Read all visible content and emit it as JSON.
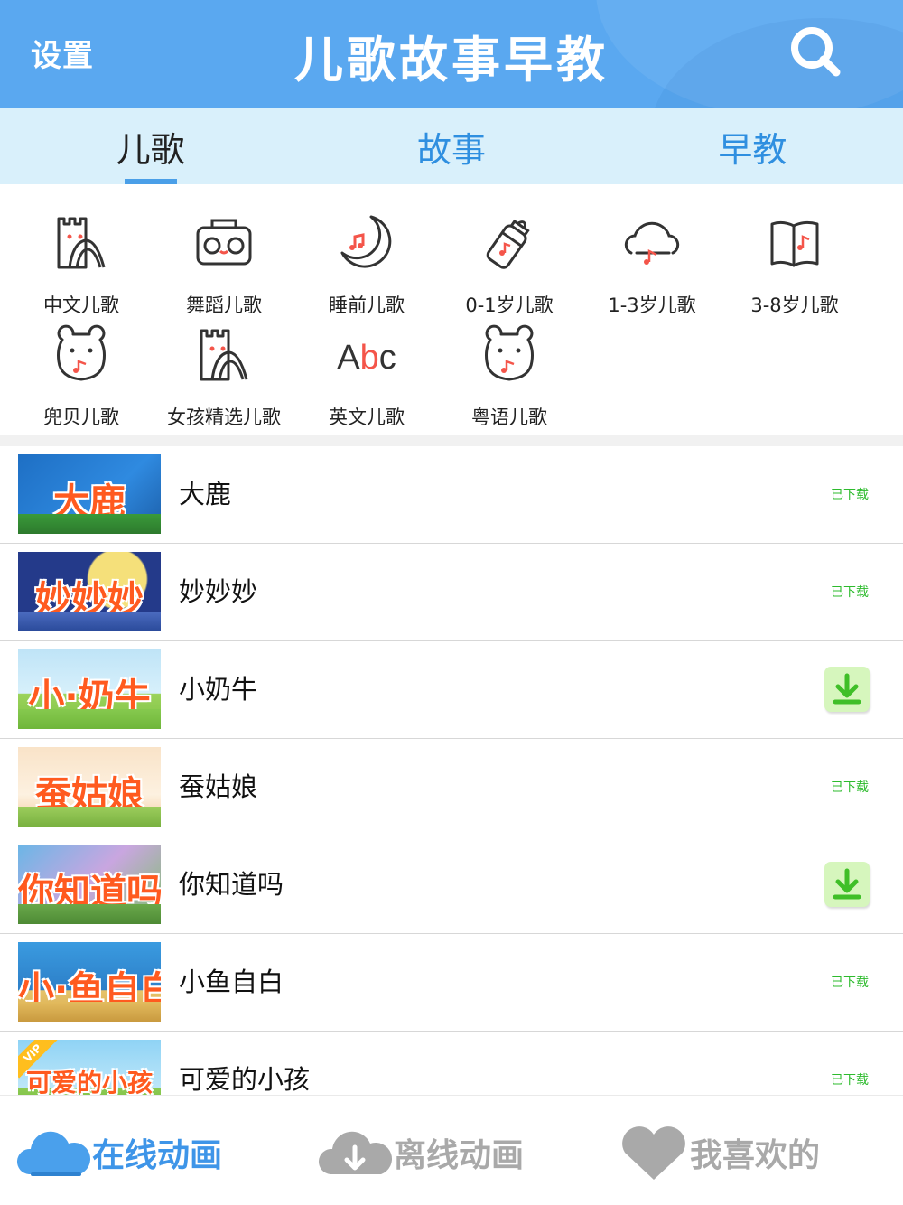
{
  "header": {
    "settings_label": "设置",
    "title": "儿歌故事早教",
    "search_icon": "search-icon"
  },
  "tabs": [
    {
      "label": "儿歌",
      "active": true
    },
    {
      "label": "故事",
      "active": false
    },
    {
      "label": "早教",
      "active": false
    }
  ],
  "categories": [
    {
      "label": "中文儿歌",
      "icon": "castle-icon"
    },
    {
      "label": "舞蹈儿歌",
      "icon": "radio-icon"
    },
    {
      "label": "睡前儿歌",
      "icon": "moon-icon"
    },
    {
      "label": "0-1岁儿歌",
      "icon": "baby-bottle-icon"
    },
    {
      "label": "1-3岁儿歌",
      "icon": "cloud-note-icon"
    },
    {
      "label": "3-8岁儿歌",
      "icon": "book-icon"
    },
    {
      "label": "兜贝儿歌",
      "icon": "bear-icon"
    },
    {
      "label": "女孩精选儿歌",
      "icon": "castle-icon"
    },
    {
      "label": "英文儿歌",
      "icon": "abc-icon"
    },
    {
      "label": "粤语儿歌",
      "icon": "bear-icon"
    }
  ],
  "songs": [
    {
      "title": "大鹿",
      "thumb_text": "大鹿",
      "status": "已下载",
      "downloaded": true
    },
    {
      "title": "妙妙妙",
      "thumb_text": "妙妙妙",
      "status": "已下载",
      "downloaded": true
    },
    {
      "title": "小奶牛",
      "thumb_text": "小·奶牛",
      "status": "",
      "downloaded": false
    },
    {
      "title": "蚕姑娘",
      "thumb_text": "蚕姑娘",
      "status": "已下载",
      "downloaded": true
    },
    {
      "title": "你知道吗",
      "thumb_text": "你知道吗",
      "status": "",
      "downloaded": false
    },
    {
      "title": "小鱼自白",
      "thumb_text": "小·鱼自白",
      "status": "已下载",
      "downloaded": true
    },
    {
      "title": "可爱的小孩",
      "thumb_text": "可爱的小孩",
      "status": "已下载",
      "downloaded": true,
      "vip_badge": "VIP"
    }
  ],
  "bottom_nav": [
    {
      "label": "在线动画",
      "icon": "cloud-icon",
      "active": true
    },
    {
      "label": "离线动画",
      "icon": "cloud-download-icon",
      "active": false
    },
    {
      "label": "我喜欢的",
      "icon": "heart-icon",
      "active": false
    }
  ],
  "colors": {
    "header_bg": "#5aa8f0",
    "tab_bar_bg": "#d9f0fb",
    "tab_text": "#2f8fe0",
    "accent_red": "#f4554a",
    "downloaded_green": "#2dbb2d",
    "download_button_bg": "#d6f6bd",
    "nav_active": "#3e95e8",
    "nav_inactive": "#a9a9a9"
  }
}
